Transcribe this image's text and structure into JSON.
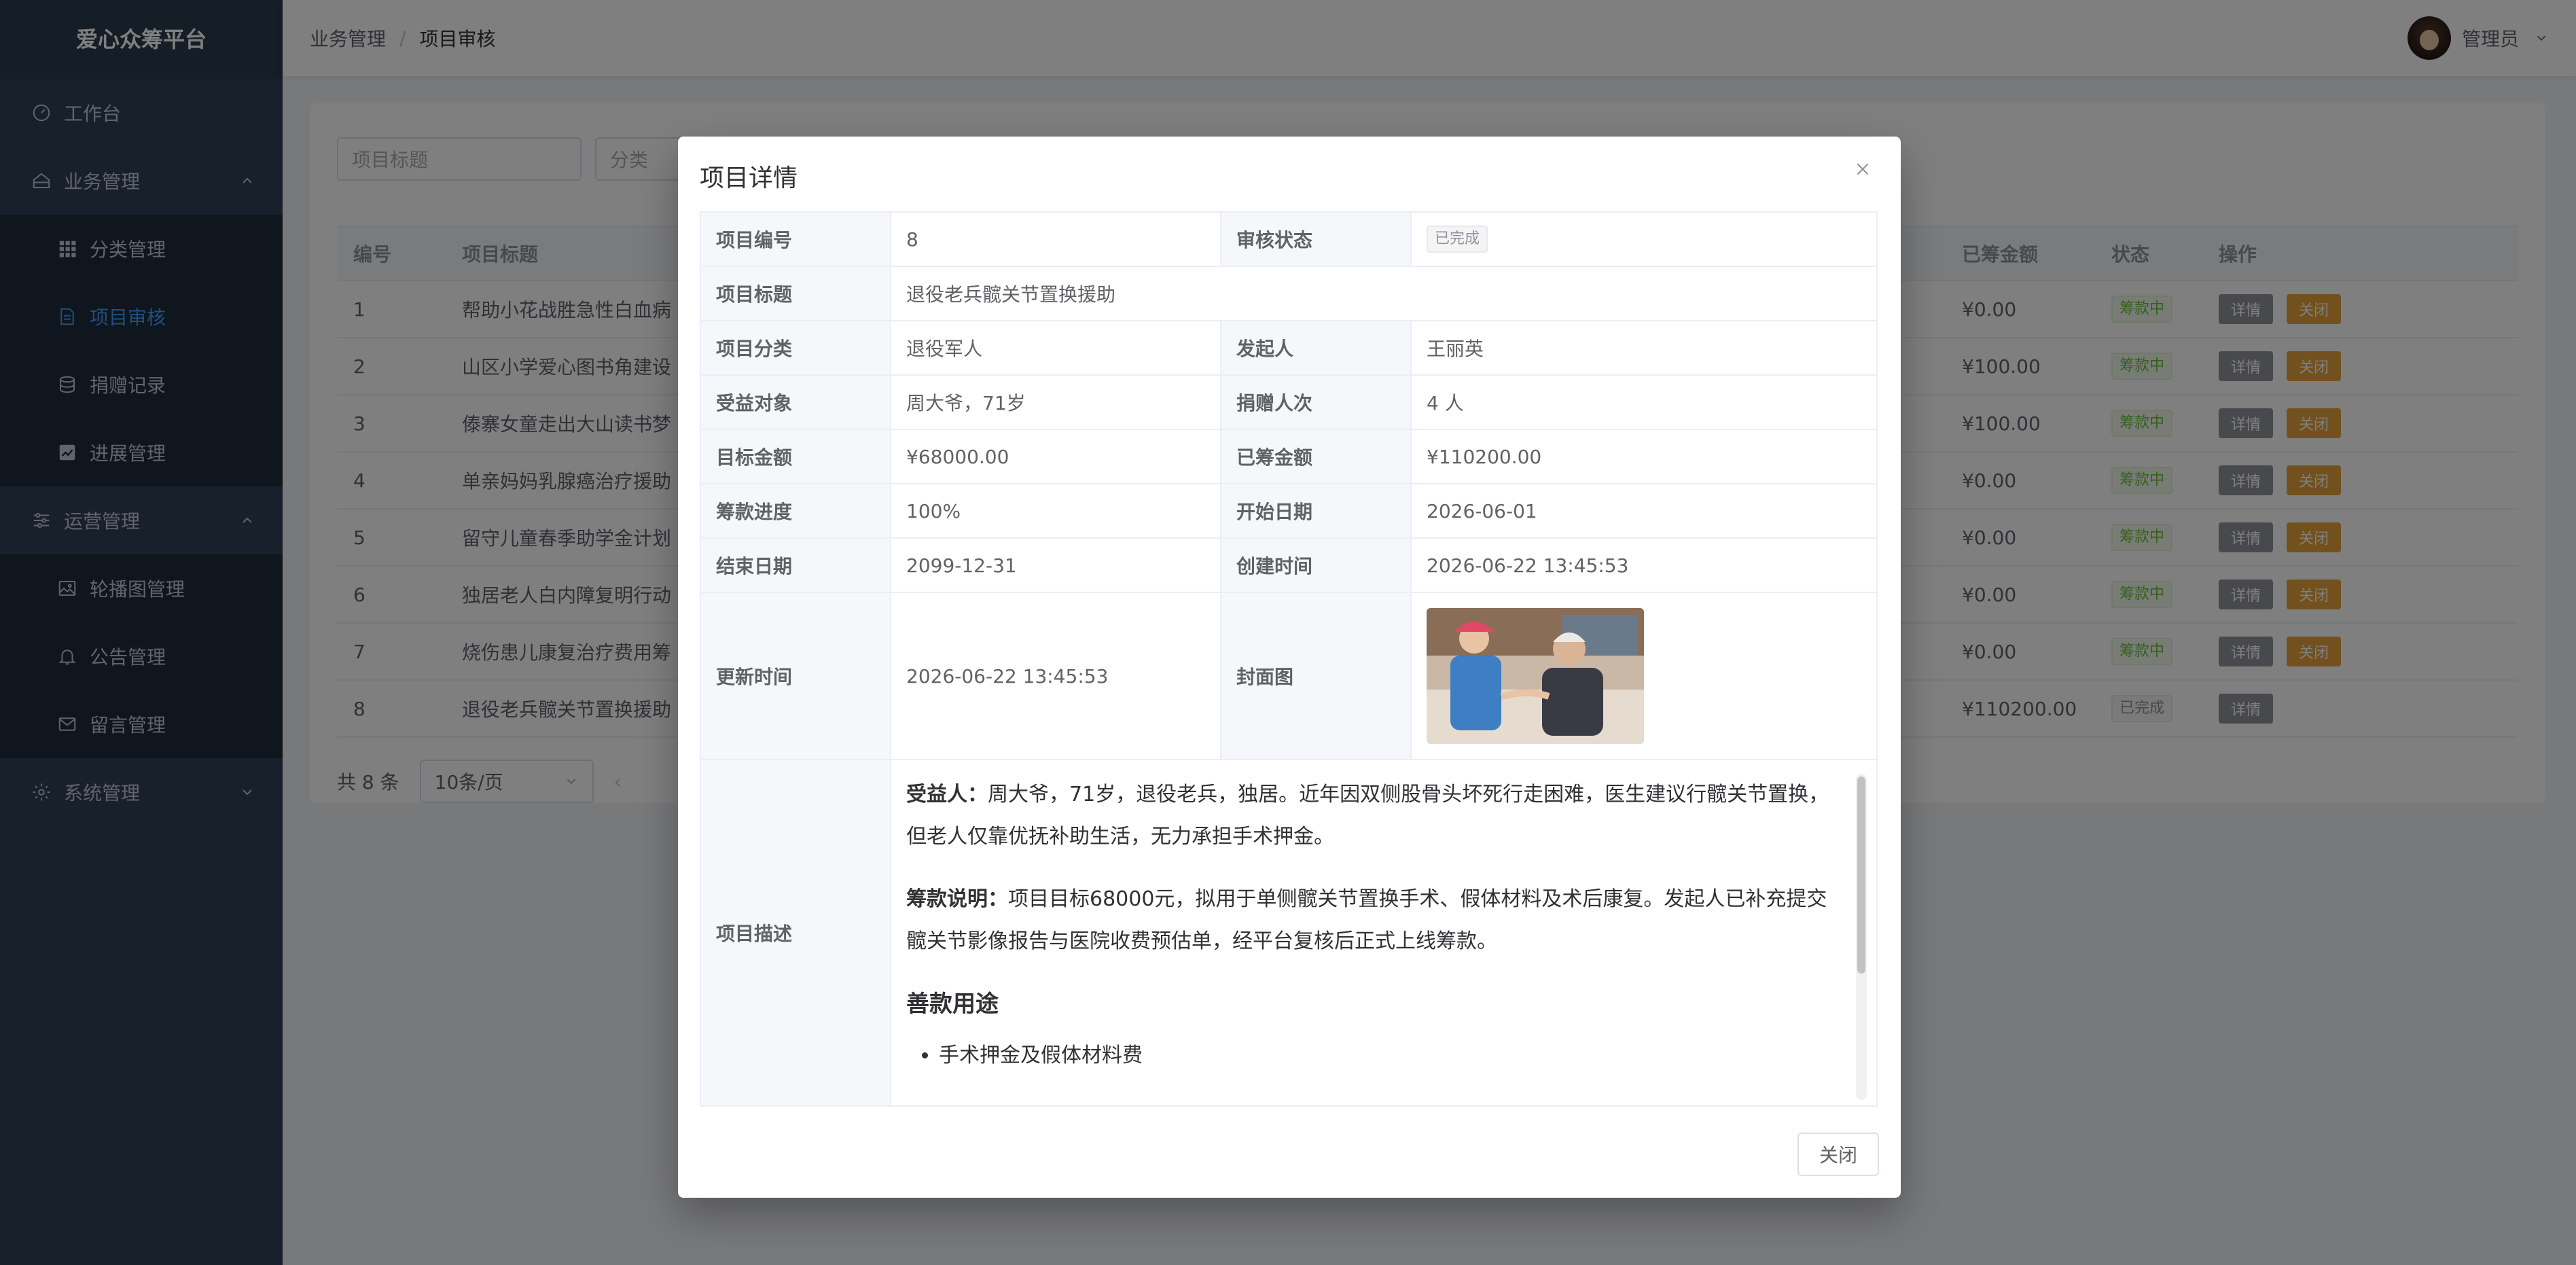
{
  "app": {
    "title": "爱心众筹平台"
  },
  "sidebar": {
    "items": [
      {
        "label": "工作台",
        "icon": "speedometer-icon"
      },
      {
        "label": "业务管理",
        "icon": "house-icon",
        "expanded": true
      },
      {
        "label": "分类管理",
        "icon": "grid-icon"
      },
      {
        "label": "项目审核",
        "icon": "document-icon",
        "active": true
      },
      {
        "label": "捐赠记录",
        "icon": "coins-icon"
      },
      {
        "label": "进展管理",
        "icon": "chart-icon"
      },
      {
        "label": "运营管理",
        "icon": "sliders-icon",
        "expanded": true
      },
      {
        "label": "轮播图管理",
        "icon": "picture-icon"
      },
      {
        "label": "公告管理",
        "icon": "bell-icon"
      },
      {
        "label": "留言管理",
        "icon": "mail-icon"
      },
      {
        "label": "系统管理",
        "icon": "gear-icon",
        "expanded": false
      }
    ]
  },
  "header": {
    "breadcrumb": [
      "业务管理",
      "项目审核"
    ],
    "separator": "/",
    "user": "管理员"
  },
  "filters": {
    "title_placeholder": "项目标题",
    "category_placeholder": "分类"
  },
  "table": {
    "headers": {
      "id": "编号",
      "title": "项目标题",
      "raised": "已筹金额",
      "status": "状态",
      "ops": "操作"
    },
    "rows": [
      {
        "id": "1",
        "title": "帮助小花战胜急性白血病",
        "raised": "¥0.00",
        "status": "筹款中"
      },
      {
        "id": "2",
        "title": "山区小学爱心图书角建设",
        "raised": "¥100.00",
        "status": "筹款中"
      },
      {
        "id": "3",
        "title": "傣寨女童走出大山读书梦",
        "raised": "¥100.00",
        "status": "筹款中"
      },
      {
        "id": "4",
        "title": "单亲妈妈乳腺癌治疗援助",
        "raised": "¥0.00",
        "status": "筹款中"
      },
      {
        "id": "5",
        "title": "留守儿童春季助学金计划",
        "raised": "¥0.00",
        "status": "筹款中"
      },
      {
        "id": "6",
        "title": "独居老人白内障复明行动",
        "raised": "¥0.00",
        "status": "筹款中"
      },
      {
        "id": "7",
        "title": "烧伤患儿康复治疗费用筹",
        "raised": "¥0.00",
        "status": "筹款中"
      },
      {
        "id": "8",
        "title": "退役老兵髋关节置换援助",
        "raised": "¥110200.00",
        "status": "已完成"
      }
    ],
    "detail_label": "详情",
    "close_label": "关闭"
  },
  "pager": {
    "total": "共 8 条",
    "page_size": "10条/页"
  },
  "dialog": {
    "title": "项目详情",
    "fields": {
      "id_label": "项目编号",
      "id": "8",
      "audit_label": "审核状态",
      "audit": "已完成",
      "title_label": "项目标题",
      "title": "退役老兵髋关节置换援助",
      "category_label": "项目分类",
      "category": "退役军人",
      "initiator_label": "发起人",
      "initiator": "王丽英",
      "beneficiary_label": "受益对象",
      "beneficiary": "周大爷，71岁",
      "donors_label": "捐赠人次",
      "donors": "4 人",
      "target_label": "目标金额",
      "target": "¥68000.00",
      "raised_label": "已筹金额",
      "raised": "¥110200.00",
      "progress_label": "筹款进度",
      "progress": "100%",
      "start_label": "开始日期",
      "start": "2026-06-01",
      "end_label": "结束日期",
      "end": "2099-12-31",
      "created_label": "创建时间",
      "created": "2026-06-22 13:45:53",
      "updated_label": "更新时间",
      "updated": "2026-06-22 13:45:53",
      "cover_label": "封面图",
      "desc_label": "项目描述"
    },
    "description": {
      "p1_bold": "受益人：",
      "p1_text": "周大爷，71岁，退役老兵，独居。近年因双侧股骨头坏死行走困难，医生建议行髋关节置换，但老人仅靠优抚补助生活，无力承担手术押金。",
      "p2_bold": "筹款说明：",
      "p2_text": "项目目标68000元，拟用于单侧髋关节置换手术、假体材料及术后康复。发起人已补充提交髋关节影像报告与医院收费预估单，经平台复核后正式上线筹款。",
      "heading": "善款用途",
      "list": [
        "手术押金及假体材料费"
      ]
    },
    "footer_close": "关闭"
  },
  "colors": {
    "sidebar_bg": "#304156",
    "accent": "#409eff",
    "success": "#67c23a",
    "warning": "#e6a23c",
    "info": "#909399"
  }
}
